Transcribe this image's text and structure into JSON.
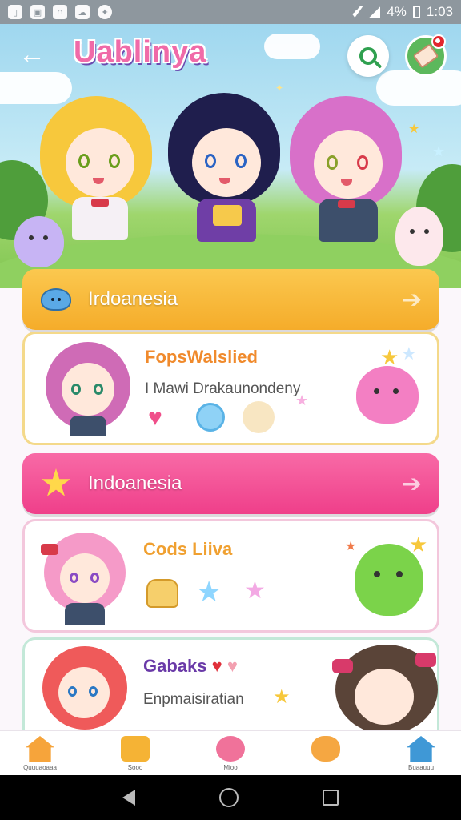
{
  "status_bar": {
    "battery": "4%",
    "time": "1:03"
  },
  "header": {
    "title": "Uablinya"
  },
  "sections": [
    {
      "label": "Irdoanesia"
    },
    {
      "label": "Indoanesia"
    }
  ],
  "cards": [
    {
      "title": "FopsWalslied",
      "subtitle": "I Mawi Drakaunondeny"
    },
    {
      "title": "Cods Liiva",
      "subtitle": ""
    },
    {
      "title": "Gabaks",
      "subtitle": "Enpmaisiratian"
    }
  ],
  "bottom_nav": [
    {
      "label": "Quuuaoaaa",
      "icon": "home-icon",
      "color": "#f6a43b"
    },
    {
      "label": "Sooo",
      "icon": "robot-icon",
      "color": "#f5b335"
    },
    {
      "label": "Mioo",
      "icon": "chat-icon",
      "color": "#f0729a"
    },
    {
      "label": "",
      "icon": "bear-icon",
      "color": "#f5a742"
    },
    {
      "label": "Buaauuu",
      "icon": "house-icon",
      "color": "#3f98d6"
    }
  ],
  "colors": {
    "banner_orange": "#f5ac2a",
    "banner_pink": "#ef3f8a",
    "accent_green": "#2fa04f"
  }
}
